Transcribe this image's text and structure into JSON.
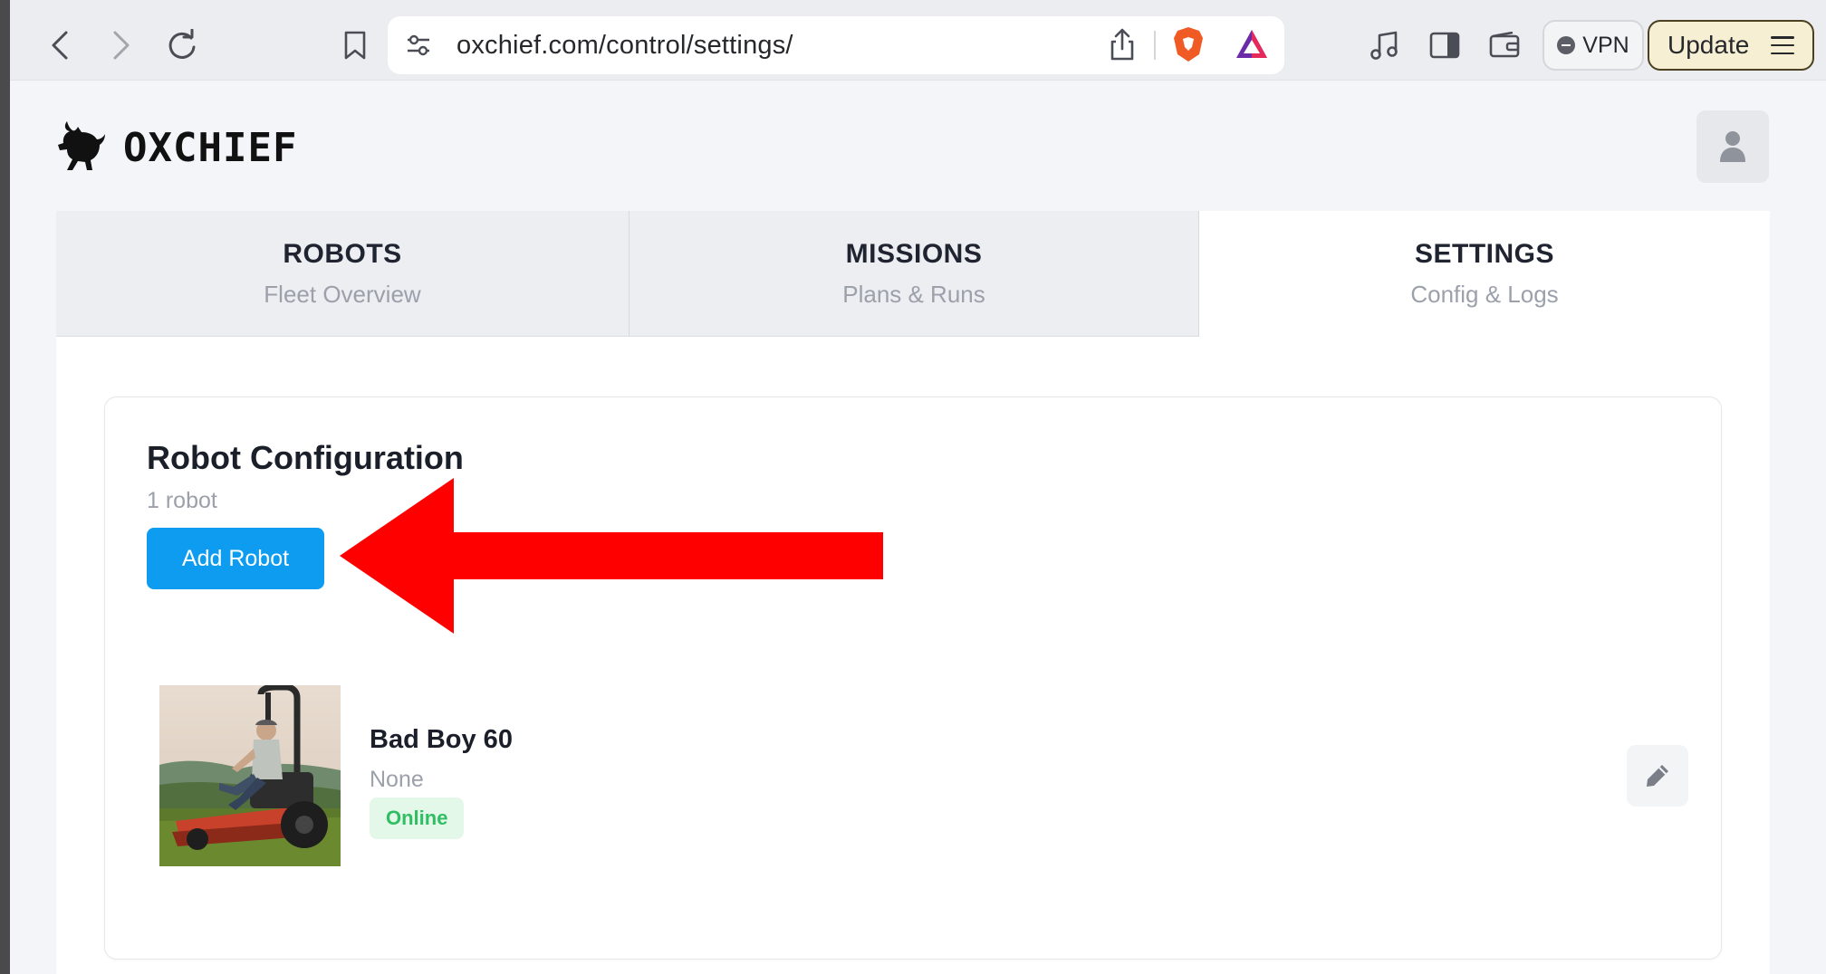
{
  "browser": {
    "url": "oxchief.com/control/settings/",
    "vpn_label": "VPN",
    "update_label": "Update"
  },
  "brand": {
    "name": "OXCHIEF"
  },
  "tabs": [
    {
      "title": "ROBOTS",
      "subtitle": "Fleet Overview",
      "active": false
    },
    {
      "title": "MISSIONS",
      "subtitle": "Plans & Runs",
      "active": false
    },
    {
      "title": "SETTINGS",
      "subtitle": "Config & Logs",
      "active": true
    }
  ],
  "settings": {
    "title": "Robot Configuration",
    "count_text": "1 robot",
    "add_button": "Add Robot",
    "robots": [
      {
        "name": "Bad Boy 60",
        "subtitle": "None",
        "status": "Online"
      }
    ]
  },
  "colors": {
    "accent": "#0d9cf0",
    "annotation_arrow": "#ff0000",
    "status_online_text": "#2fbe62",
    "status_online_bg": "#e4f8ea"
  }
}
